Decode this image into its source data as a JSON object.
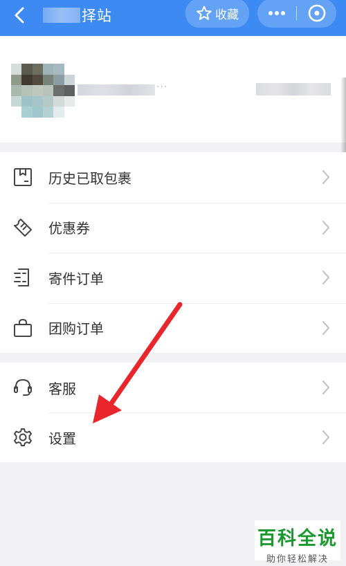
{
  "header": {
    "back_icon": "chevron-left-icon",
    "title": "驿站",
    "title_visible_fragment": "择站",
    "favorite_icon": "star-outline-icon",
    "favorite_label": "收藏",
    "more_icon": "more-dots-icon",
    "close_icon": "close-circle-icon",
    "color": "#3d8bf2"
  },
  "profile": {
    "dots": "···"
  },
  "menu_group_1": [
    {
      "label": "历史已取包裹",
      "icon": "package-box-icon"
    },
    {
      "label": "优惠券",
      "icon": "coupon-ticket-icon"
    },
    {
      "label": "寄件订单",
      "icon": "send-order-icon"
    },
    {
      "label": "团购订单",
      "icon": "shopping-bag-icon"
    }
  ],
  "menu_group_2": [
    {
      "label": "客服",
      "icon": "headset-icon"
    },
    {
      "label": "设置",
      "icon": "gear-icon"
    }
  ],
  "annotation": {
    "arrow_color": "#e8262b"
  },
  "watermark": {
    "main": "百科全说",
    "sub": "助你轻松解决"
  }
}
